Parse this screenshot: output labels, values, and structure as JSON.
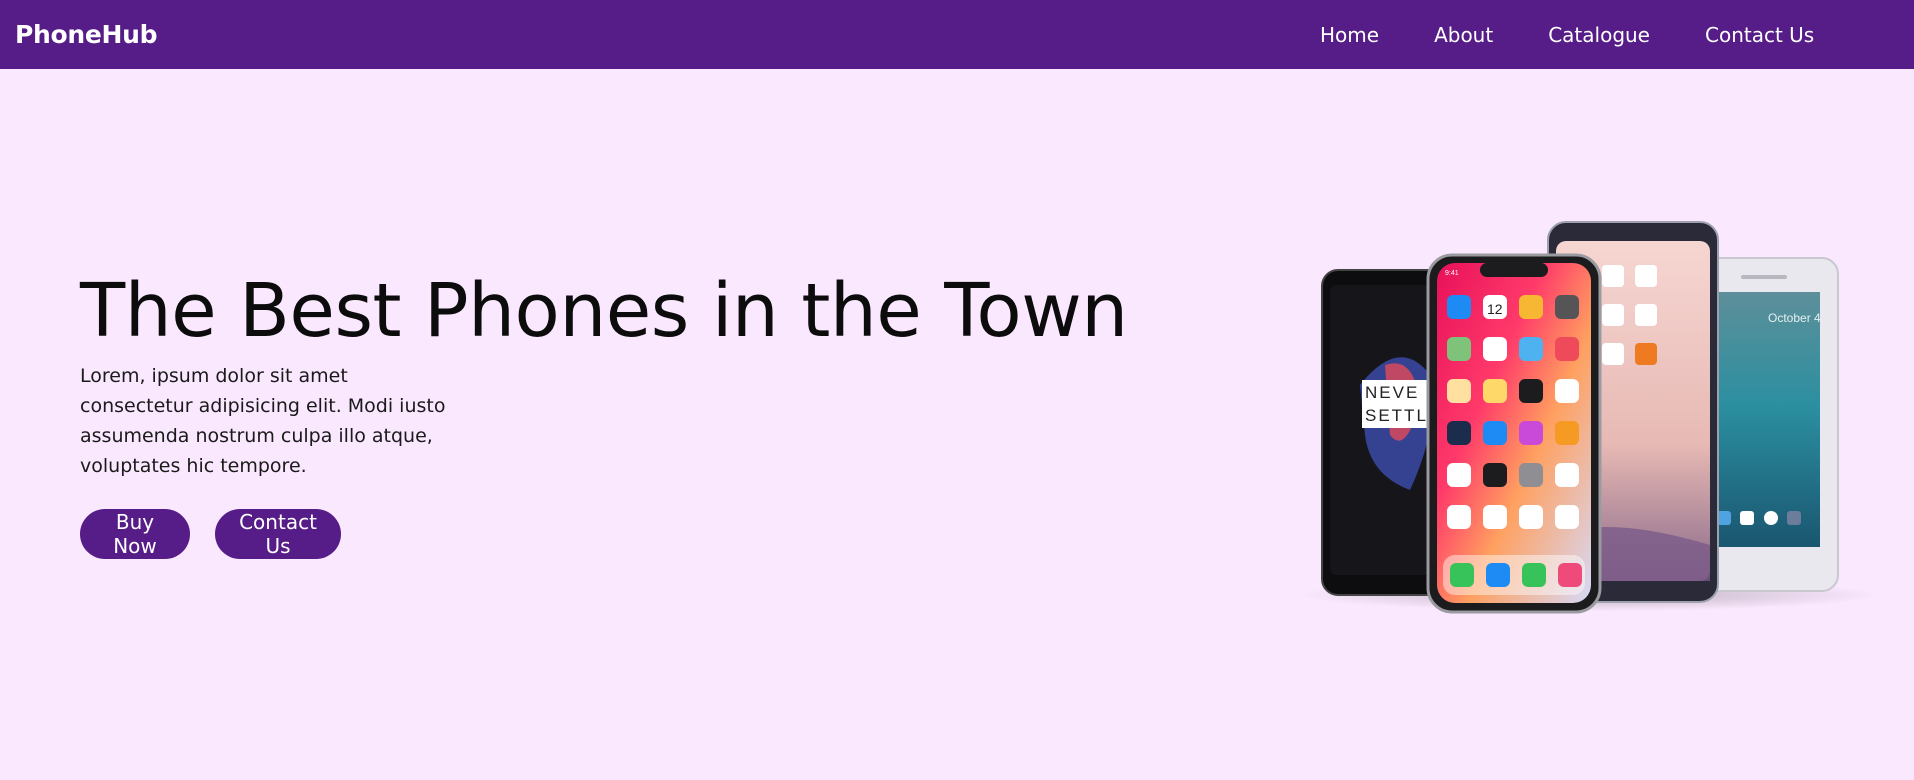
{
  "header": {
    "brand": "PhoneHub",
    "nav": [
      {
        "label": "Home"
      },
      {
        "label": "About"
      },
      {
        "label": "Catalogue"
      },
      {
        "label": "Contact Us"
      }
    ]
  },
  "hero": {
    "title": "The Best Phones in the Town",
    "description": "Lorem, ipsum dolor sit amet consectetur adipisicing elit. Modi iusto assumenda nostrum culpa illo atque, voluptates hic tempore.",
    "buttons": {
      "buy_label": "Buy Now",
      "contact_label": "Contact Us"
    },
    "image": {
      "kind": "phones-product-photo",
      "phone_texts": {
        "oneplus_line1": "NEVE",
        "oneplus_line2": "SETTL",
        "iphone_time": "9:41",
        "calendar_day": "12",
        "pixel_date": "October 4"
      }
    }
  },
  "colors": {
    "brand_purple": "#561c87",
    "page_background": "#fae8fe",
    "nav_text": "#ffffff"
  }
}
